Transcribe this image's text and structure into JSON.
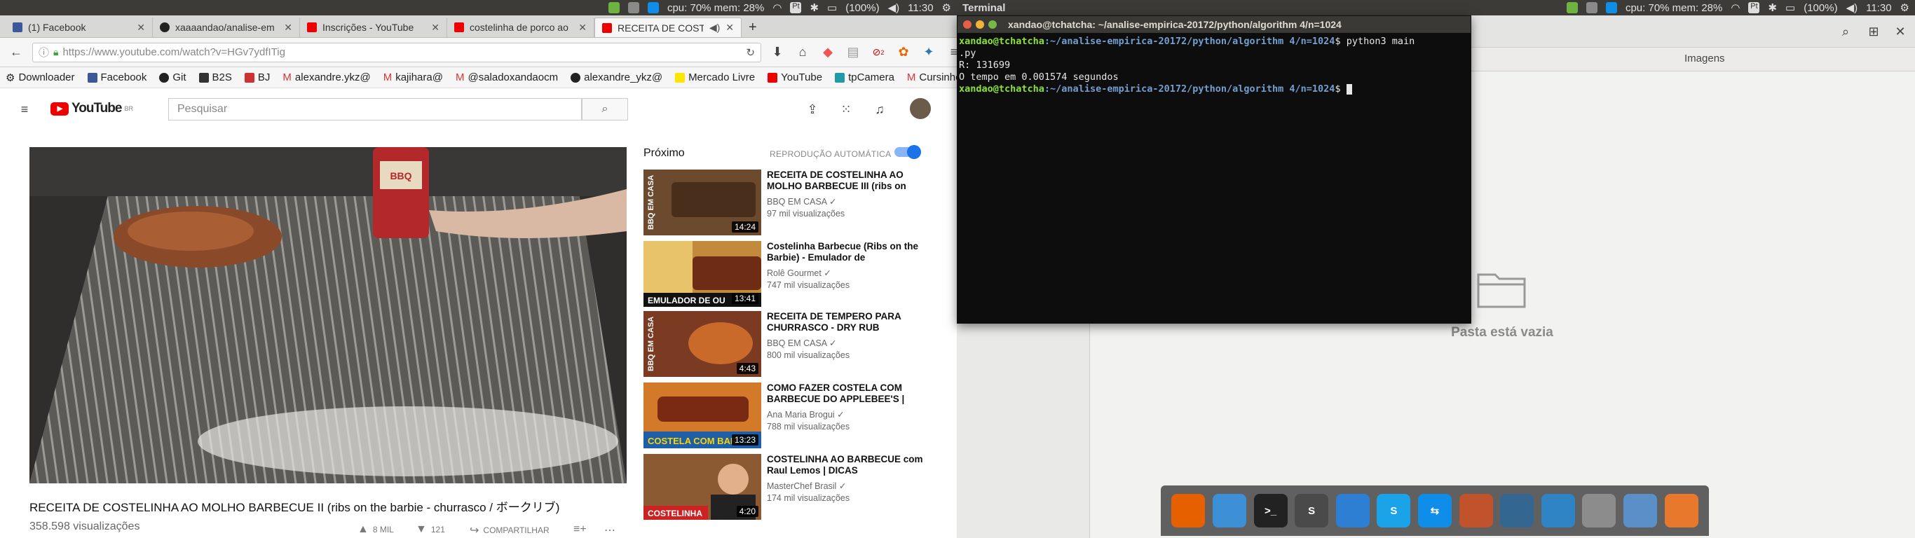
{
  "top_panel_left": {
    "sysmon": "cpu: 70% mem: 28%",
    "battery": "(100%)",
    "clock": "11:30",
    "app_name": "Terminal"
  },
  "top_panel_right": {
    "sysmon": "cpu: 70% mem: 28%",
    "battery": "(100%)",
    "clock": "11:30"
  },
  "browser": {
    "tabs": [
      {
        "label": "(1) Facebook",
        "icon": "facebook-icon"
      },
      {
        "label": "xaaaandao/analise-em",
        "icon": "github-icon"
      },
      {
        "label": "Inscrições - YouTube",
        "icon": "youtube-icon"
      },
      {
        "label": "costelinha de porco ao",
        "icon": "youtube-icon"
      },
      {
        "label": "RECEITA DE COSTEL",
        "icon": "youtube-icon"
      }
    ],
    "url": "https://www.youtube.com/watch?v=HGv7ydfITig",
    "badge_count": "2",
    "bookmarks": [
      "Downloader",
      "Facebook",
      "Git",
      "B2S",
      "BJ",
      "alexandre.ykz@",
      "kajihara@",
      "@saladoxandaocm",
      "alexandre_ykz@",
      "Mercado Livre",
      "YouTube",
      "tpCamera",
      "Cursinho"
    ]
  },
  "youtube": {
    "logo": "YouTube",
    "logo_region": "BR",
    "search_placeholder": "Pesquisar",
    "video_title": "RECEITA DE COSTELINHA AO MOLHO BARBECUE II (ribs on the barbie - churrasco / ボークリブ)",
    "views": "358.598 visualizações",
    "likes": "8 MIL",
    "dislikes": "121",
    "share_label": "COMPARTILHAR",
    "next_label": "Próximo",
    "autoplay_label": "REPRODUÇÃO AUTOMÁTICA",
    "can_label": "BBQ",
    "suggestions": [
      {
        "title": "RECEITA DE COSTELINHA AO MOLHO BARBECUE III (ribs on",
        "channel": "BBQ EM CASA",
        "views": "97 mil visualizações",
        "duration": "14:24",
        "thumb_text": "BBQ EM CASA",
        "thumb_color": "#6b4a2e"
      },
      {
        "title": "Costelinha Barbecue (Ribs on the Barbie) - Emulador de",
        "channel": "Rolê Gourmet",
        "views": "747 mil visualizações",
        "duration": "13:41",
        "thumb_text": "EMULADOR DE OU",
        "thumb_color": "#c28a3c"
      },
      {
        "title": "RECEITA DE TEMPERO PARA CHURRASCO - DRY RUB",
        "channel": "BBQ EM CASA",
        "views": "800 mil visualizações",
        "duration": "4:43",
        "thumb_text": "BBQ EM CASA",
        "thumb_color": "#7a3b22"
      },
      {
        "title": "COMO FAZER COSTELA COM BARBECUE DO APPLEBEE'S |",
        "channel": "Ana Maria Brogui",
        "views": "788 mil visualizações",
        "duration": "13:23",
        "thumb_text": "COSTELA COM BAR",
        "thumb_color": "#d27a2a"
      },
      {
        "title": "COSTELINHA AO BARBECUE com Raul Lemos | DICAS",
        "channel": "MasterChef Brasil",
        "views": "174 mil visualizações",
        "duration": "4:20",
        "thumb_text": "COSTELINHA",
        "thumb_color": "#8b5a33"
      }
    ]
  },
  "files": {
    "header_title": "Imagens",
    "empty_text": "Pasta está vazia"
  },
  "terminal": {
    "title": "xandao@tchatcha: ~/analise-empirica-20172/python/algorithm 4/n=1024",
    "prompt_user": "xandao@tchatcha",
    "prompt_path": ":~/analise-empirica-20172/python/algorithm 4/n=1024",
    "prompt_symbol": "$",
    "command_1": " python3 main",
    "command_1b": ".py",
    "output_1": "R: 131699",
    "output_2": "O tempo em 0.001574 segundos",
    "command_2": " "
  },
  "dock": [
    {
      "name": "firefox",
      "color": "#e66000",
      "label": ""
    },
    {
      "name": "finder",
      "color": "#3d8fd6",
      "label": ""
    },
    {
      "name": "terminal",
      "color": "#222222",
      "label": ">_"
    },
    {
      "name": "sublime",
      "color": "#4a4a4a",
      "label": "S"
    },
    {
      "name": "dropbox",
      "color": "#2d7fd3",
      "label": ""
    },
    {
      "name": "skype",
      "color": "#1aa3e8",
      "label": "S"
    },
    {
      "name": "teamviewer",
      "color": "#0e8ee9",
      "label": "⇆"
    },
    {
      "name": "matlab",
      "color": "#c0532b",
      "label": ""
    },
    {
      "name": "postgresql",
      "color": "#336791",
      "label": ""
    },
    {
      "name": "mysql-workbench",
      "color": "#2f84c6",
      "label": ""
    },
    {
      "name": "scanner",
      "color": "#8c8c8c",
      "label": ""
    },
    {
      "name": "virtualbox",
      "color": "#5a8fc8",
      "label": ""
    },
    {
      "name": "gitkraken",
      "color": "#e8782b",
      "label": ""
    }
  ]
}
